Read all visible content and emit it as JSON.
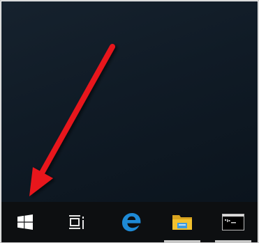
{
  "taskbar": {
    "buttons": [
      {
        "icon": "windows-start-icon",
        "running": false
      },
      {
        "icon": "task-view-icon",
        "running": false
      },
      {
        "icon": "edge-browser-icon",
        "running": false
      },
      {
        "icon": "file-explorer-icon",
        "running": true
      },
      {
        "icon": "command-prompt-icon",
        "running": true
      }
    ]
  },
  "annotation": {
    "icon": "red-arrow-icon",
    "color": "#e8191e"
  },
  "colors": {
    "desktop": "#111c27",
    "taskbar": "#0d0f11",
    "windows_logo": "#ffffff",
    "edge_blue": "#1e8ad6",
    "folder_yellow": "#f2c12e"
  }
}
